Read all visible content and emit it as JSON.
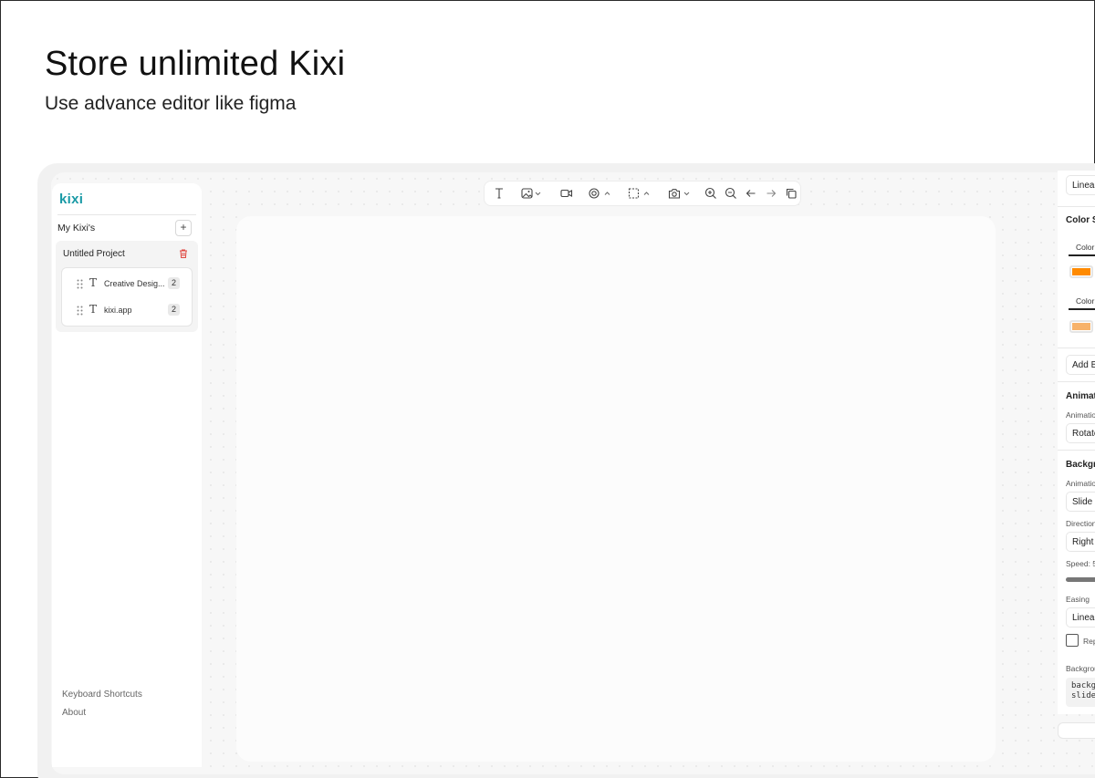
{
  "hero": {
    "title": "Store unlimited Kixi",
    "subtitle": "Use advance editor like figma"
  },
  "sidebar": {
    "logo": "kixi",
    "section_title": "My Kixi's",
    "add_label": "+",
    "project": {
      "name": "Untitled Project",
      "layers": [
        {
          "label": "Creative Desig...",
          "count": "2"
        },
        {
          "label": "kixi.app",
          "count": "2"
        }
      ]
    },
    "footer": {
      "shortcuts": "Keyboard Shortcuts",
      "about": "About"
    }
  },
  "toolbar": {
    "tools": [
      "text-tool",
      "image-tool",
      "video-tool",
      "shape-tool",
      "selection-tool",
      "camera-tool",
      "zoom-in",
      "zoom-out",
      "undo",
      "redo",
      "duplicate"
    ]
  },
  "right_panel": {
    "easing_top_value": "Linear",
    "color_stops_title": "Color S",
    "color_tab_1": "Color",
    "color_tab_2": "Color",
    "color_1": "#ff8a00",
    "color_2": "#f7b26a",
    "add_button": "Add B",
    "animation_title": "Animat",
    "animation_label": "Animatio",
    "animation_value": "Rotate",
    "background_title": "Backgro",
    "bg_animation_label": "Animatio",
    "bg_animation_value": "Slide",
    "direction_label": "Direction",
    "direction_value": "Right",
    "speed_label": "Speed: 5",
    "easing_label": "Easing",
    "easing_value": "Linear",
    "repeat_label": "Rep",
    "bg_code_label": "Backgrou",
    "bg_code_line1": "backgr",
    "bg_code_line2": "slideB"
  }
}
